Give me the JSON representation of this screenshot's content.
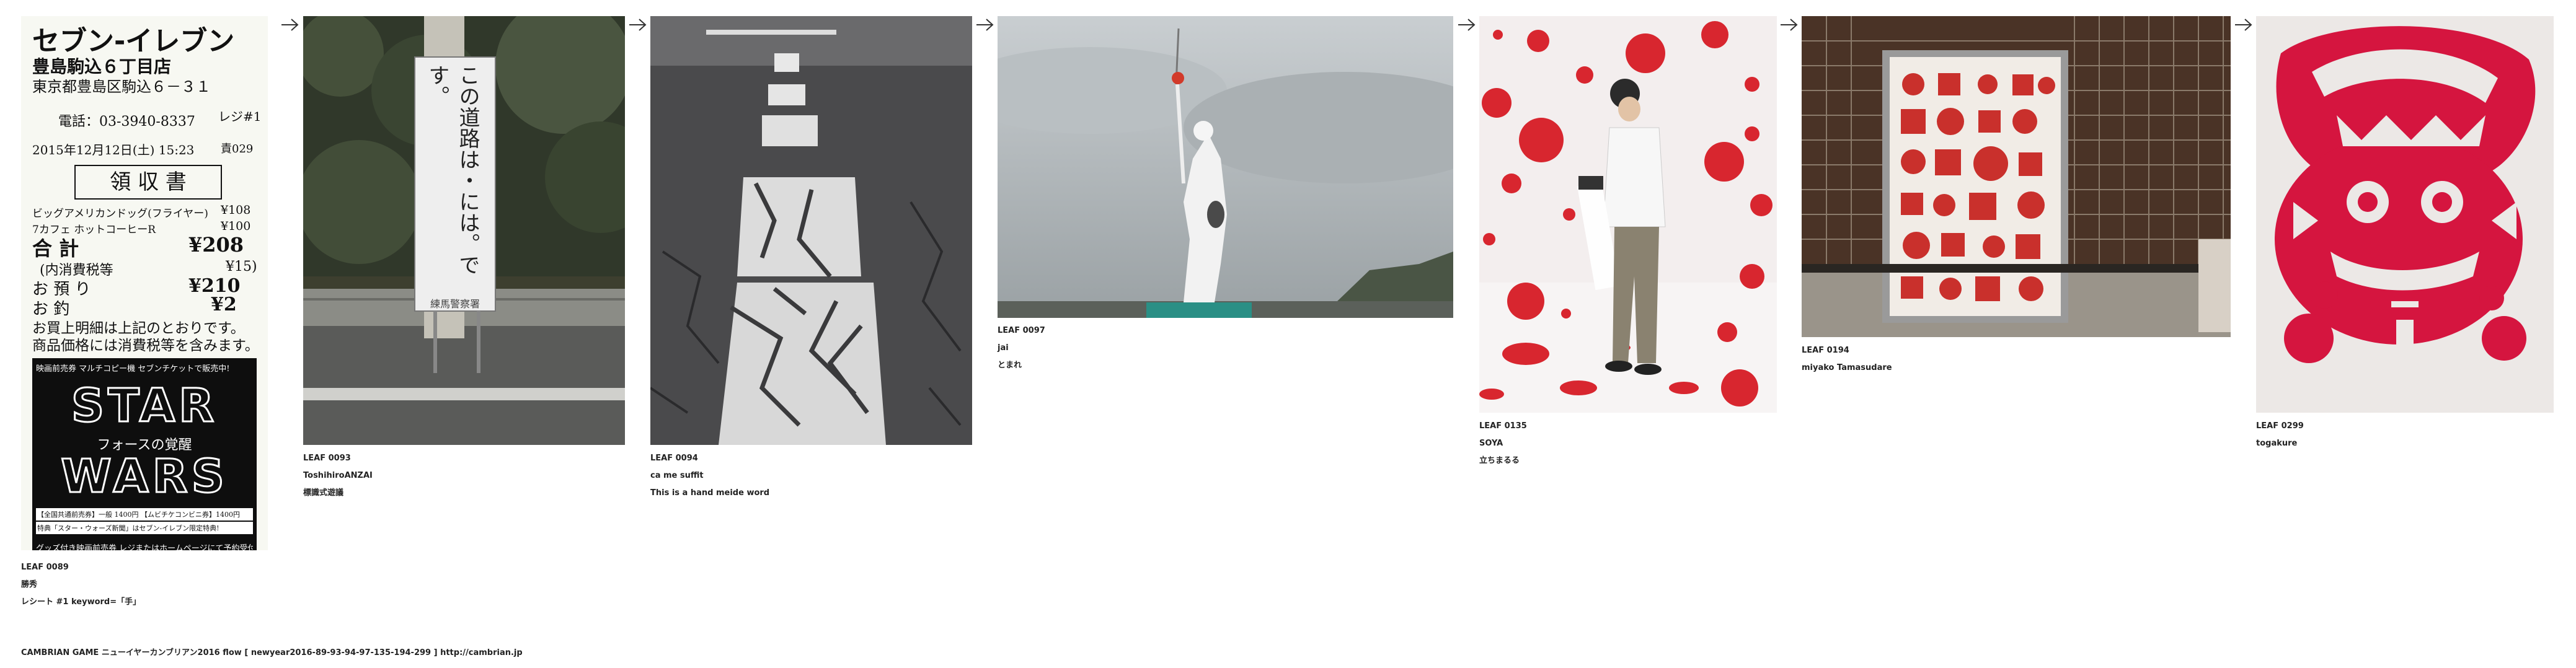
{
  "leaves": [
    {
      "id": "LEAF 0089",
      "author": "勝秀",
      "comment": "レシート #1 keyword=「手」"
    },
    {
      "id": "LEAF 0093",
      "author": "ToshihiroANZAI",
      "comment": "標識式遊議"
    },
    {
      "id": "LEAF 0094",
      "author": "ca me suffit",
      "comment": "This is a hand meide word"
    },
    {
      "id": "LEAF 0097",
      "author": "jai",
      "comment": "とまれ"
    },
    {
      "id": "LEAF 0135",
      "author": "SOYA",
      "comment": "立ちまるる"
    },
    {
      "id": "LEAF 0194",
      "author": "miyako Tamasudare",
      "comment": ""
    },
    {
      "id": "LEAF 0299",
      "author": "togakure",
      "comment": ""
    }
  ],
  "receipt": {
    "logo": "セブン-イレブン",
    "store": "豊島駒込６丁目店",
    "address": "東京都豊島区駒込６－３１",
    "phone": "電話：03-3940-8337",
    "register": "レジ#1",
    "datetime": "2015年12月12日(土) 15:23",
    "staff": "責029",
    "title": "領 収 書",
    "item1": "ビッグアメリカンドッグ(フライヤー)",
    "item1_price": "¥108",
    "item2": "7カフェ ホットコーヒーR",
    "item2_price": "¥100",
    "total_label": "合 計",
    "total": "¥208",
    "tax_label": "(内消費税等",
    "tax": "¥15)",
    "paid_label": "お 預 り",
    "paid": "¥210",
    "change_label": "お 釣",
    "change": "¥2",
    "note1": "お買上明細は上記のとおりです。",
    "note2": "商品価格には消費税等を含みます。",
    "ad_top": "映画前売券 マルチコピー機 セブンチケットで販売中!",
    "ad_title1": "STAR",
    "ad_subtitle": "フォースの覚醒",
    "ad_title2": "WARS",
    "ad_price": "【全国共通前売券】一般 1400円 【ムビチケコンビニ券】1400円",
    "ad_bonus": "特典「スター・ウォーズ新聞」はセブン-イレブン限定特典!",
    "ad_bottom": "グッズ付き映画前売券 レジまたはホームページにて予約受付中!"
  },
  "sign_text": "この道路は・には。です。",
  "sign_footer": "練馬警察署",
  "footer": "CAMBRIAN GAME  ニューイヤーカンブリアン2016  flow [ newyear2016-89-93-94-97-135-194-299 ]    http://cambrian.jp"
}
